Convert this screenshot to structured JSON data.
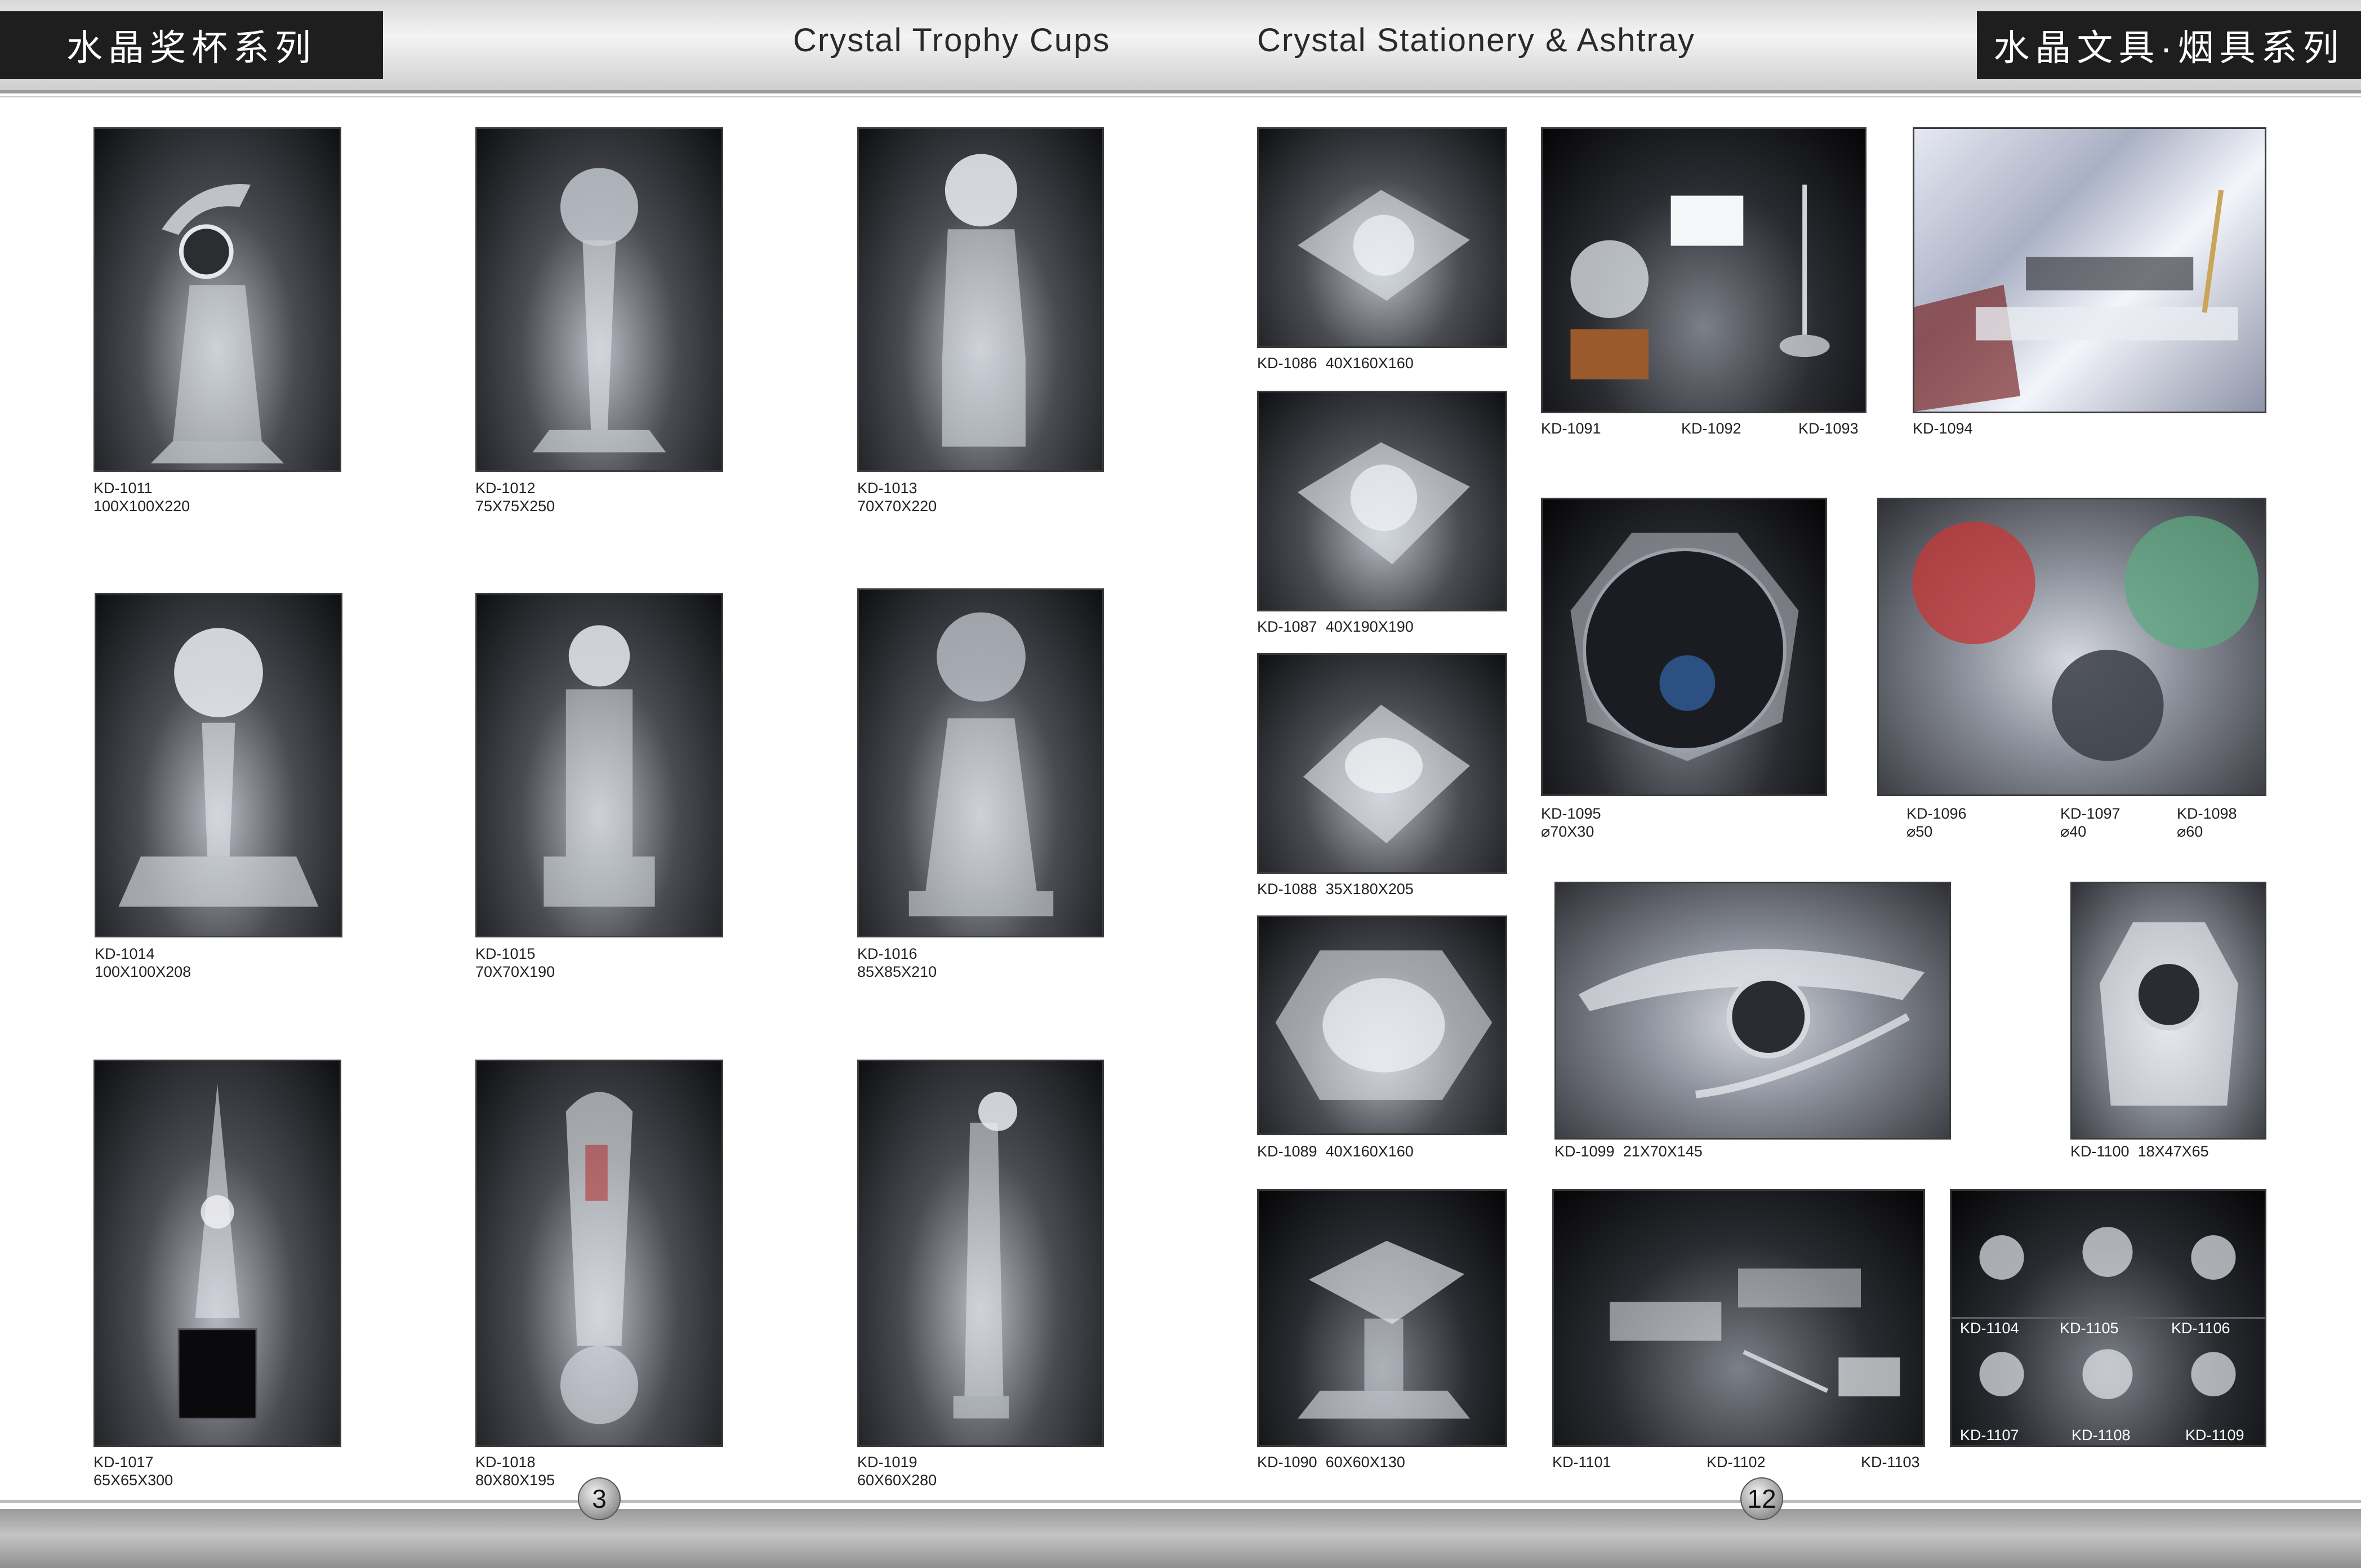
{
  "header": {
    "left_title": "水晶奖杯系列",
    "left_en": "Crystal Trophy Cups",
    "right_en": "Crystal Stationery & Ashtray",
    "right_title": "水晶文具·烟具系列"
  },
  "pages": {
    "left": "3",
    "right": "12"
  },
  "trophies": [
    {
      "code": "KD-1011",
      "size": "100X100X220"
    },
    {
      "code": "KD-1012",
      "size": "75X75X250"
    },
    {
      "code": "KD-1013",
      "size": "70X70X220"
    },
    {
      "code": "KD-1014",
      "size": "100X100X208"
    },
    {
      "code": "KD-1015",
      "size": "70X70X190"
    },
    {
      "code": "KD-1016",
      "size": "85X85X210"
    },
    {
      "code": "KD-1017",
      "size": "65X65X300"
    },
    {
      "code": "KD-1018",
      "size": "80X80X195"
    },
    {
      "code": "KD-1019",
      "size": "60X60X280"
    }
  ],
  "ashtrays": [
    {
      "code": "KD-1086",
      "size": "40X160X160"
    },
    {
      "code": "KD-1087",
      "size": "40X190X190"
    },
    {
      "code": "KD-1088",
      "size": "35X180X205"
    },
    {
      "code": "KD-1089",
      "size": "40X160X160"
    },
    {
      "code": "KD-1090",
      "size": "60X60X130"
    }
  ],
  "stationery": {
    "set1": [
      "KD-1091",
      "KD-1092",
      "KD-1093"
    ],
    "set2": "KD-1094",
    "p1095": {
      "code": "KD-1095",
      "size": "⌀70X30"
    },
    "balls": [
      {
        "code": "KD-1096",
        "size": "⌀50"
      },
      {
        "code": "KD-1097",
        "size": "⌀40"
      },
      {
        "code": "KD-1098",
        "size": "⌀60"
      }
    ],
    "p1099": {
      "code": "KD-1099",
      "size": "21X70X145"
    },
    "p1100": {
      "code": "KD-1100",
      "size": "18X47X65"
    },
    "set3": [
      "KD-1101",
      "KD-1102",
      "KD-1103"
    ],
    "clocks": [
      "KD-1104",
      "KD-1105",
      "KD-1106",
      "KD-1107",
      "KD-1108",
      "KD-1109"
    ]
  }
}
